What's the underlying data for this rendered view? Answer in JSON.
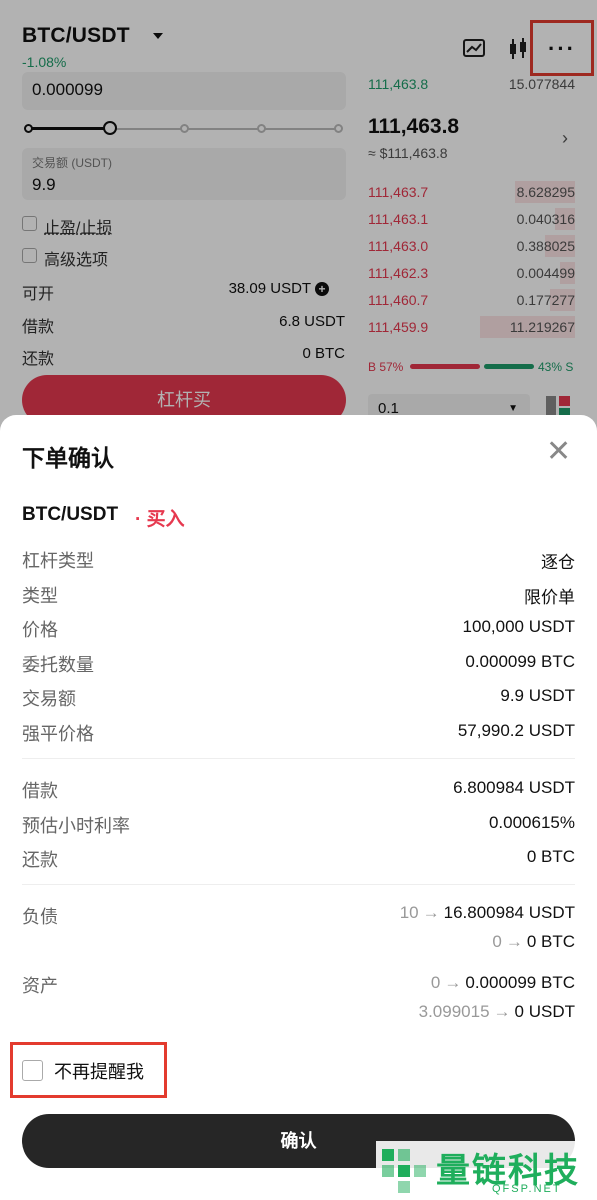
{
  "header": {
    "pair": "BTC/USDT",
    "change": "-1.08%",
    "icons": [
      "chart-settings-icon",
      "candlestick-icon",
      "more-icon"
    ]
  },
  "order_form": {
    "amount_value": "0.000099",
    "slider_percent": 25,
    "trade_amount_label": "交易额 (USDT)",
    "trade_amount_value": "9.9",
    "tp_sl_label": "止盈/止损",
    "advanced_label": "高级选项",
    "available_label": "可开",
    "available_value": "38.09 USDT",
    "borrow_label": "借款",
    "borrow_value": "6.8 USDT",
    "repay_label": "还款",
    "repay_value": "0 BTC",
    "buy_button": "杠杆买"
  },
  "orderbook": {
    "top_row": {
      "price": "111,463.8",
      "qty": "15.077844"
    },
    "mid_price": "111,463.8",
    "mid_price_usd": "≈ $111,463.8",
    "asks": [
      {
        "price": "111,463.7",
        "qty": "8.628295"
      },
      {
        "price": "111,463.1",
        "qty": "0.040316"
      },
      {
        "price": "111,463.0",
        "qty": "0.388025"
      },
      {
        "price": "111,462.3",
        "qty": "0.004499"
      },
      {
        "price": "111,460.7",
        "qty": "0.177277"
      },
      {
        "price": "111,459.9",
        "qty": "11.219267"
      }
    ],
    "buy_ratio": "B 57%",
    "sell_ratio": "43% S",
    "depth": "0.1"
  },
  "modal": {
    "title": "下单确认",
    "pair": "BTC/USDT",
    "side": "· 买入",
    "rows1": [
      {
        "label": "杠杆类型",
        "value": "逐仓"
      },
      {
        "label": "类型",
        "value": "限价单"
      },
      {
        "label": "价格",
        "value": "100,000 USDT"
      },
      {
        "label": "委托数量",
        "value": "0.000099 BTC"
      },
      {
        "label": "交易额",
        "value": "9.9 USDT"
      },
      {
        "label": "强平价格",
        "value": "57,990.2 USDT"
      }
    ],
    "rows2": [
      {
        "label": "借款",
        "value": "6.800984 USDT"
      },
      {
        "label": "预估小时利率",
        "value": "0.000615%"
      },
      {
        "label": "还款",
        "value": "0 BTC"
      }
    ],
    "liability_label": "负债",
    "liability": [
      {
        "from": "10",
        "to": "16.800984 USDT"
      },
      {
        "from": "0",
        "to": "0 BTC"
      }
    ],
    "assets_label": "资产",
    "assets": [
      {
        "from": "0",
        "to": "0.000099 BTC"
      },
      {
        "from": "3.099015",
        "to": "0 USDT"
      }
    ],
    "no_remind_label": "不再提醒我",
    "confirm_button": "确认"
  },
  "watermark": {
    "text": "量链科技",
    "sub": "QFSP.NET"
  }
}
